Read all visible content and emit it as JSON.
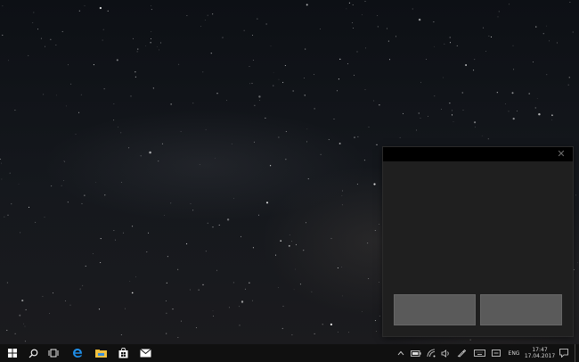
{
  "desktop": {
    "wallpaper": "starry-night-sky"
  },
  "dialog": {
    "title": "",
    "close_glyph": "✕",
    "buttons": [
      {
        "label": ""
      },
      {
        "label": ""
      }
    ]
  },
  "taskbar": {
    "pinned": [
      {
        "name": "start-icon"
      },
      {
        "name": "search-icon"
      },
      {
        "name": "task-view-icon"
      },
      {
        "name": "edge-icon"
      },
      {
        "name": "file-explorer-icon"
      },
      {
        "name": "store-icon"
      },
      {
        "name": "mail-icon"
      }
    ],
    "tray": {
      "language": "ENG",
      "time": "17:47",
      "date": "17.04.2017"
    }
  },
  "colors": {
    "taskbar": "#101010",
    "dialog_bg": "#1f1f1f",
    "dialog_titlebar": "#000000",
    "dialog_button": "#5a5a5a",
    "edge_blue": "#1f8ee8",
    "explorer_yellow": "#f0c040"
  }
}
